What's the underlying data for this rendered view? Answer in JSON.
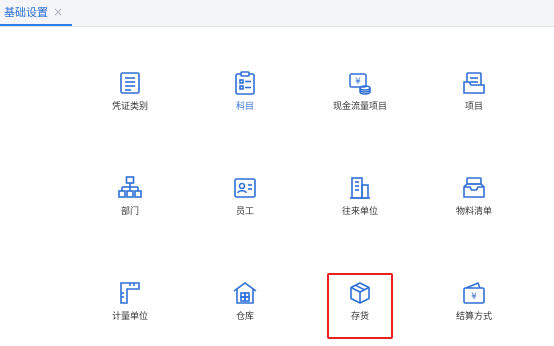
{
  "tab": {
    "label": "基础设置",
    "close_glyph": "×"
  },
  "accent_color": "#2f80ed",
  "highlight_color": "#e8221a",
  "items": [
    {
      "id": "voucher-type",
      "label": "凭证类别",
      "icon": "voucher-icon"
    },
    {
      "id": "accounts",
      "label": "科目",
      "icon": "clipboard-list-icon",
      "state": "selected"
    },
    {
      "id": "cash-flow-items",
      "label": "现金流量项目",
      "icon": "cash-flow-icon"
    },
    {
      "id": "projects",
      "label": "项目",
      "icon": "folder-icon"
    },
    {
      "id": "department",
      "label": "部门",
      "icon": "org-chart-icon"
    },
    {
      "id": "employee",
      "label": "员工",
      "icon": "employee-card-icon"
    },
    {
      "id": "contact-unit",
      "label": "往来单位",
      "icon": "building-icon"
    },
    {
      "id": "material-list",
      "label": "物料清单",
      "icon": "inbox-tray-icon"
    },
    {
      "id": "unit-of-measure",
      "label": "计量单位",
      "icon": "ruler-icon"
    },
    {
      "id": "warehouse",
      "label": "仓库",
      "icon": "warehouse-icon"
    },
    {
      "id": "inventory",
      "label": "存货",
      "icon": "box-icon",
      "state": "highlighted"
    },
    {
      "id": "settlement-method",
      "label": "结算方式",
      "icon": "wallet-icon"
    }
  ]
}
